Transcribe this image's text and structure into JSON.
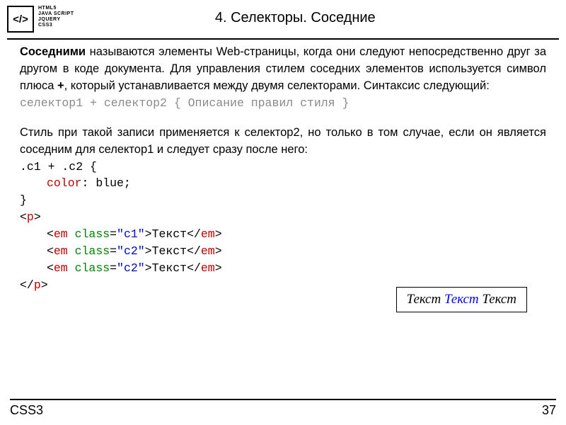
{
  "logo": {
    "symbol": "</>",
    "lines": [
      "HTML5",
      "JAVA SCRIPT",
      "JQUERY",
      "CSS3"
    ]
  },
  "title": "4. Селекторы. Соседние",
  "para1": {
    "bold": "Соседними",
    "text1": " называются элементы Web-страницы, когда они следуют непосредственно друг за другом в коде документа. Для управления стилем соседних элементов используется символ плюса ",
    "plus": "+",
    "text2": ", который устанавливается между двумя селекторами. Синтаксис следующий:"
  },
  "syntax": "селектор1 + селектор2 { Описание правил стиля }",
  "para2": "Стиль при такой записи применяется к селектор2, но только в том случае, если он является соседним для селектор1 и следует сразу после него:",
  "code": {
    "l1a": ".c1 + .c2 {",
    "l2a": "color",
    "l2b": ": blue;",
    "l3": "}",
    "l4a": "<",
    "l4b": "p",
    "l4c": ">",
    "em_open_a": "<",
    "em_open_b": "em",
    "em_attr": " class",
    "em_eq": "=",
    "em_v1": "\"c1\"",
    "em_v2": "\"c2\"",
    "em_open_c": ">",
    "em_text": "Текст",
    "em_close_a": "</",
    "em_close_b": "em",
    "em_close_c": ">",
    "l8a": "</",
    "l8b": "p",
    "l8c": ">"
  },
  "example": {
    "t1": "Текст ",
    "t2": "Текст ",
    "t3": "Текст"
  },
  "footer": {
    "left": "CSS3",
    "right": "37"
  }
}
